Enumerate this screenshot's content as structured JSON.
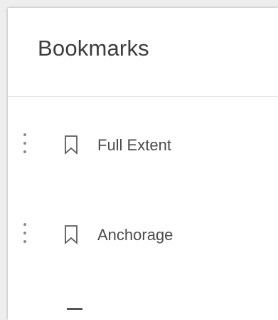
{
  "panel": {
    "title": "Bookmarks"
  },
  "bookmarks": [
    {
      "label": "Full Extent"
    },
    {
      "label": "Anchorage"
    }
  ],
  "icons": {
    "drag": "drag-handle-icon",
    "bookmark": "bookmark-icon"
  },
  "colors": {
    "title": "#3c3c3c",
    "label": "#4a4a4a",
    "icon": "#5a5a5a",
    "divider": "#e6e6e6"
  }
}
